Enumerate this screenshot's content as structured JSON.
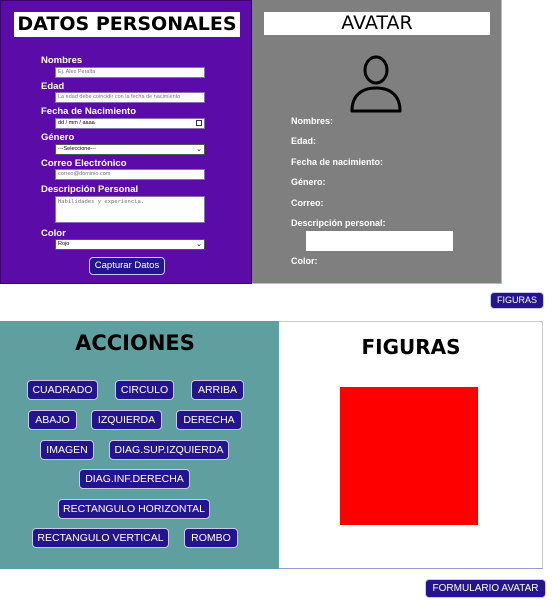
{
  "datos_personales": {
    "title": "DATOS PERSONALES",
    "fields": {
      "nombres": {
        "label": "Nombres",
        "placeholder": "Ej. Alex Peralta"
      },
      "edad": {
        "label": "Edad",
        "placeholder": "La edad debe coincidir con la fecha de nacimiento"
      },
      "fecha": {
        "label": "Fecha de Nacimiento",
        "value": "dd / mm / aaaa"
      },
      "genero": {
        "label": "Género",
        "value": "---Seleccione---"
      },
      "correo": {
        "label": "Correo Electrónico",
        "placeholder": "correo@dominio.com"
      },
      "descripcion": {
        "label": "Descripción Personal",
        "placeholder": "Habilidades y experiencia."
      },
      "color": {
        "label": "Color",
        "value": "Rojo"
      }
    },
    "submit_label": "Capturar Datos"
  },
  "avatar": {
    "title": "AVATAR",
    "icon": "user-icon",
    "labels": {
      "nombres": "Nombres:",
      "edad": "Edad:",
      "fecha": "Fecha de nacimiento:",
      "genero": "Género:",
      "correo": "Correo:",
      "descripcion": "Descripción personal:",
      "color": "Color:"
    }
  },
  "nav": {
    "figuras_label": "FIGURAS",
    "formulario_label": "FORMULARIO AVATAR"
  },
  "acciones": {
    "title": "ACCIONES",
    "buttons": {
      "cuadrado": "CUADRADO",
      "circulo": "CIRCULO",
      "arriba": "ARRIBA",
      "abajo": "ABAJO",
      "izquierda": "IZQUIERDA",
      "derecha": "DERECHA",
      "imagen": "IMAGEN",
      "diag_sup_izq": "DIAG.SUP.IZQUIERDA",
      "diag_inf_der": "DIAG.INF.DERECHA",
      "rect_horizontal": "RECTANGULO HORIZONTAL",
      "rect_vertical": "RECTANGULO VERTICAL",
      "rombo": "ROMBO"
    }
  },
  "figuras": {
    "title": "FIGURAS",
    "shape": "square",
    "shape_color": "#ff0000"
  },
  "colors": {
    "form_bg": "#5b0ba8",
    "avatar_bg": "#7f7f7f",
    "acciones_bg": "#5f9fa0",
    "button_bg": "#24148f"
  }
}
